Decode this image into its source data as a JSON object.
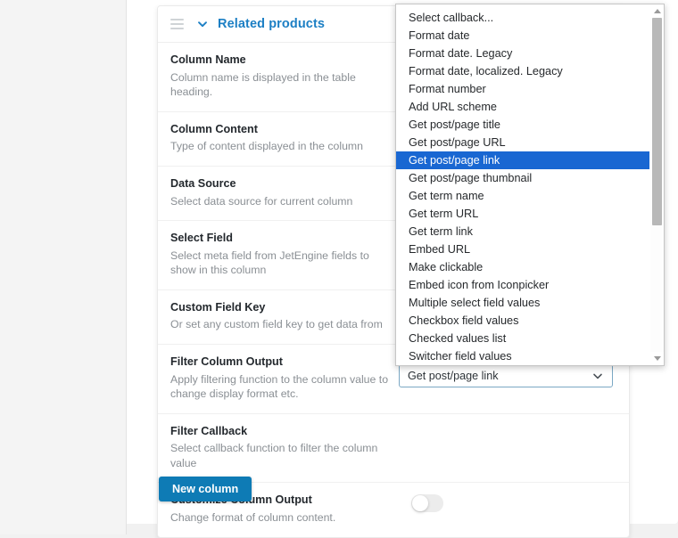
{
  "card": {
    "title": "Related products",
    "drag_handle_icon": "drag-handle-icon",
    "collapse_icon": "chevron-down-icon",
    "rows": [
      {
        "label": "Column Name",
        "desc": "Column name is displayed in the table heading."
      },
      {
        "label": "Column Content",
        "desc": "Type of content displayed in the column"
      },
      {
        "label": "Data Source",
        "desc": "Select data source for current column"
      },
      {
        "label": "Select Field",
        "desc": "Select meta field from JetEngine fields to show in this column"
      },
      {
        "label": "Custom Field Key",
        "desc": "Or set any custom field key to get data from"
      },
      {
        "label": "Filter Column Output",
        "desc": "Apply filtering function to the column value to change display format etc."
      },
      {
        "label": "Filter Callback",
        "desc": "Select callback function to filter the column value"
      },
      {
        "label": "Customize Column Output",
        "desc": "Change format of column content."
      }
    ],
    "toggle": {
      "name": "customize-column-output-toggle",
      "state": "off"
    }
  },
  "actions": {
    "new_column_label": "New column"
  },
  "callback_select": {
    "value": "Get post/page link",
    "chevron_icon": "chevron-down-icon"
  },
  "dropdown": {
    "selected": "Get post/page link",
    "scroll_up_icon": "triangle-up-icon",
    "scroll_down_icon": "triangle-down-icon",
    "options": [
      "Select callback...",
      "Format date",
      "Format date. Legacy",
      "Format date, localized. Legacy",
      "Format number",
      "Add URL scheme",
      "Get post/page title",
      "Get post/page URL",
      "Get post/page link",
      "Get post/page thumbnail",
      "Get term name",
      "Get term URL",
      "Get term link",
      "Embed URL",
      "Make clickable",
      "Embed icon from Iconpicker",
      "Multiple select field values",
      "Checkbox field values",
      "Checked values list",
      "Switcher field values"
    ]
  },
  "colors": {
    "accent_blue": "#1c7fc4",
    "button_blue": "#0e7bb5",
    "highlight_blue": "#1967d2",
    "page_background": "#f1f1f1"
  }
}
